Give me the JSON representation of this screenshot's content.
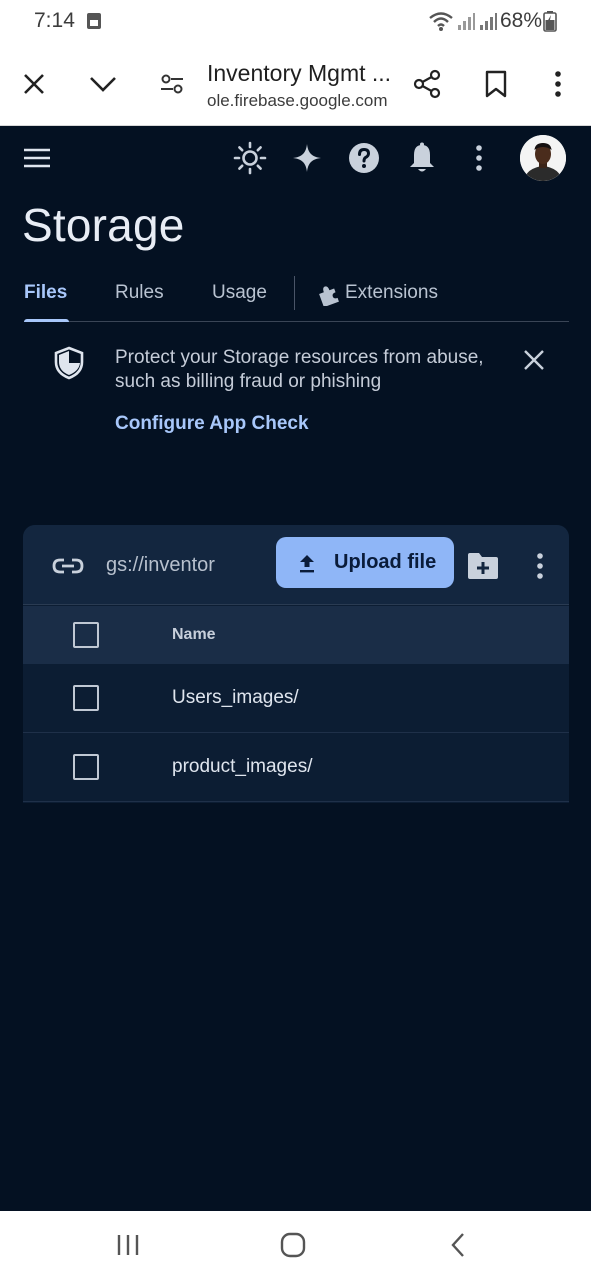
{
  "status_bar": {
    "time": "7:14",
    "battery": "68%"
  },
  "browser": {
    "page_title": "Inventory Mgmt ...",
    "url": "ole.firebase.google.com"
  },
  "app": {
    "title": "Storage",
    "tabs": [
      {
        "label": "Files",
        "active": true
      },
      {
        "label": "Rules",
        "active": false
      },
      {
        "label": "Usage",
        "active": false
      },
      {
        "label": "Extensions",
        "active": false
      }
    ],
    "notice": {
      "text": "Protect your Storage resources from abuse, such as billing fraud or phishing",
      "link": "Configure App Check"
    },
    "bucket": {
      "path": "gs://inventor",
      "upload_label": "Upload file"
    },
    "table": {
      "header_name": "Name",
      "rows": [
        {
          "name": "Users_images/"
        },
        {
          "name": "product_images/"
        }
      ]
    }
  },
  "colors": {
    "background": "#041122",
    "accent": "#a8c7fa",
    "upload_button": "#8fb6f7"
  }
}
